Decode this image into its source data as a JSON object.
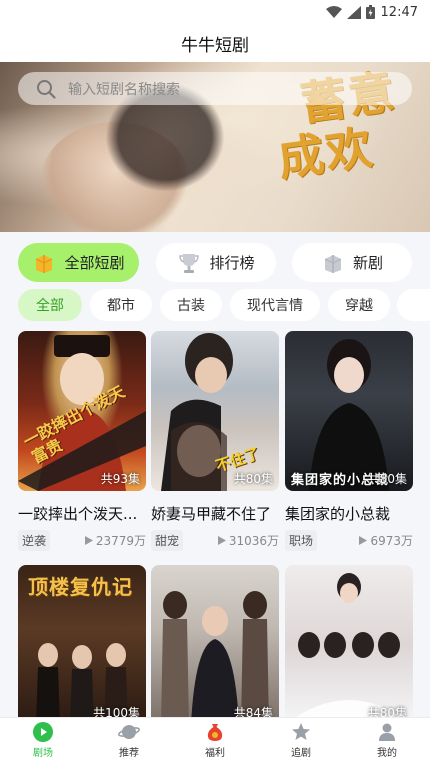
{
  "status_bar": {
    "time": "12:47"
  },
  "app": {
    "title": "牛牛短剧"
  },
  "banner": {
    "poster_title_line1": "蓄意",
    "poster_title_line2": "成欢"
  },
  "search": {
    "placeholder": "输入短剧名称搜索"
  },
  "categories": [
    {
      "label": "全部短剧",
      "icon": "gift-box-icon",
      "active": true
    },
    {
      "label": "排行榜",
      "icon": "trophy-icon",
      "active": false
    },
    {
      "label": "新剧",
      "icon": "new-box-icon",
      "active": false
    }
  ],
  "tags": [
    {
      "label": "全部",
      "active": true
    },
    {
      "label": "都市",
      "active": false
    },
    {
      "label": "古装",
      "active": false
    },
    {
      "label": "现代言情",
      "active": false
    },
    {
      "label": "穿越",
      "active": false
    }
  ],
  "dramas": [
    {
      "title": "一跤摔出个泼天...",
      "episodes": "共93集",
      "genre": "逆袭",
      "views": "23779万"
    },
    {
      "title": "娇妻马甲藏不住了",
      "episodes": "共80集",
      "genre": "甜宠",
      "views": "31036万"
    },
    {
      "title": "集团家的小总裁",
      "episodes": "共80集",
      "genre": "职场",
      "views": "6973万"
    },
    {
      "title": "",
      "episodes": "共100集",
      "genre": "",
      "views": ""
    },
    {
      "title": "",
      "episodes": "共84集",
      "genre": "",
      "views": ""
    },
    {
      "title": "",
      "episodes": "共80集",
      "genre": "",
      "views": ""
    }
  ],
  "poster_text": {
    "p1": "一跤摔出个泼天富贵",
    "p2": "不住了",
    "p3": "集团家的小总裁",
    "p4": "顶楼复仇记"
  },
  "tabbar": [
    {
      "label": "剧场",
      "icon": "play-circle-icon",
      "active": true
    },
    {
      "label": "推荐",
      "icon": "planet-icon",
      "active": false
    },
    {
      "label": "福利",
      "icon": "money-bag-icon",
      "active": false
    },
    {
      "label": "追剧",
      "icon": "star-icon",
      "active": false
    },
    {
      "label": "我的",
      "icon": "user-icon",
      "active": false
    }
  ],
  "colors": {
    "accent": "#2fbf4a",
    "active_category_bg": "#a6f06c",
    "active_tag_bg": "#d7f7c6",
    "poster_title": "#e1a22f"
  }
}
